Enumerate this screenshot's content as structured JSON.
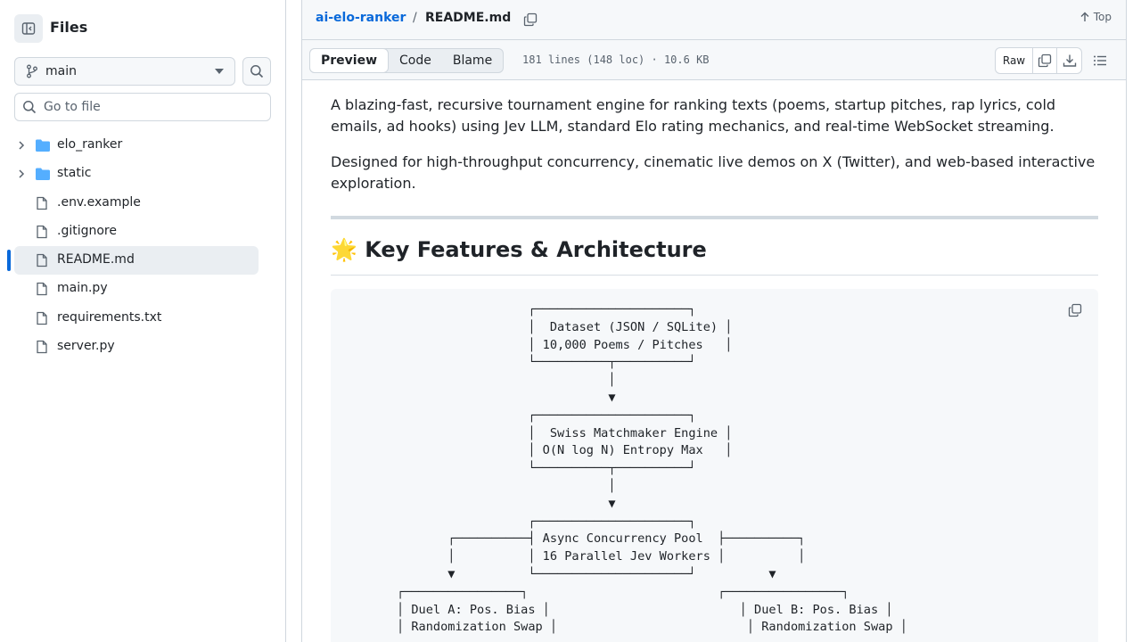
{
  "sidebar": {
    "title": "Files",
    "branch": "main",
    "goto_placeholder": "Go to file",
    "items": [
      {
        "name": "elo_ranker",
        "type": "folder"
      },
      {
        "name": "static",
        "type": "folder"
      },
      {
        "name": ".env.example",
        "type": "file"
      },
      {
        "name": ".gitignore",
        "type": "file"
      },
      {
        "name": "README.md",
        "type": "file",
        "selected": true
      },
      {
        "name": "main.py",
        "type": "file"
      },
      {
        "name": "requirements.txt",
        "type": "file"
      },
      {
        "name": "server.py",
        "type": "file"
      }
    ]
  },
  "breadcrumb": {
    "repo": "ai-elo-ranker",
    "separator": "/",
    "file": "README.md",
    "top_label": "Top"
  },
  "toolbar": {
    "tabs": [
      "Preview",
      "Code",
      "Blame"
    ],
    "active_tab": "Preview",
    "file_info": "181 lines (148 loc) · 10.6 KB",
    "raw_label": "Raw"
  },
  "readme": {
    "para1": "A blazing-fast, recursive tournament engine for ranking texts (poems, startup pitches, rap lyrics, cold emails, ad hooks) using Jev LLM, standard Elo rating mechanics, and real-time WebSocket streaming.",
    "para2": "Designed for high-throughput concurrency, cinematic live demos on X (Twitter), and web-based interactive exploration.",
    "heading_emoji": "🌟",
    "heading": "Key Features & Architecture",
    "diagram": "                  ┌─────────────────────┐\n                  │  Dataset (JSON / SQLite) │\n                  │ 10,000 Poems / Pitches   │\n                  └──────────┬──────────┘\n                             │\n                             ▼\n                  ┌─────────────────────┐\n                  │  Swiss Matchmaker Engine │\n                  │ O(N log N) Entropy Max   │\n                  └──────────┬──────────┘\n                             │\n                             ▼\n                  ┌─────────────────────┐\n       ┌──────────┤ Async Concurrency Pool  ├──────────┐\n       │          │ 16 Parallel Jev Workers │          │\n       ▼          └─────────────────────┘          ▼\n┌────────────────┐                          ┌────────────────┐\n│ Duel A: Pos. Bias │                          │ Duel B: Pos. Bias │\n│ Randomization Swap │                          │ Randomization Swap │"
  }
}
